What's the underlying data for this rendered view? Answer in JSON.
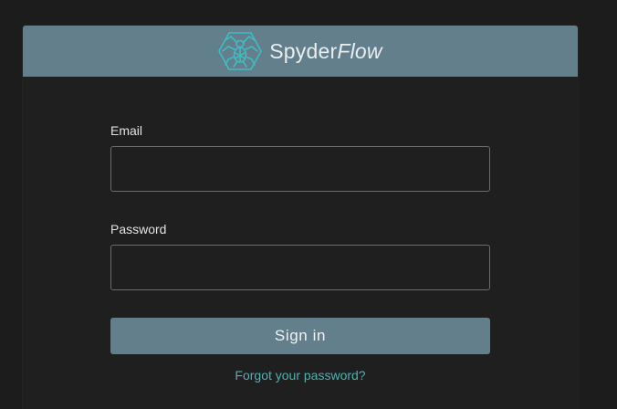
{
  "brand": {
    "name_regular": "Spyder",
    "name_italic": "Flow",
    "logo_icon": "spider-hexagon-icon",
    "accent_color": "#3fbcc2",
    "header_color": "#637f8b"
  },
  "form": {
    "email_label": "Email",
    "email_value": "",
    "email_placeholder": "",
    "password_label": "Password",
    "password_value": "",
    "password_placeholder": "",
    "submit_label": "Sign in",
    "forgot_link": "Forgot your password?"
  },
  "colors": {
    "background": "#1c1c1c",
    "card": "#1f1f1f",
    "link": "#4fb1b4"
  }
}
